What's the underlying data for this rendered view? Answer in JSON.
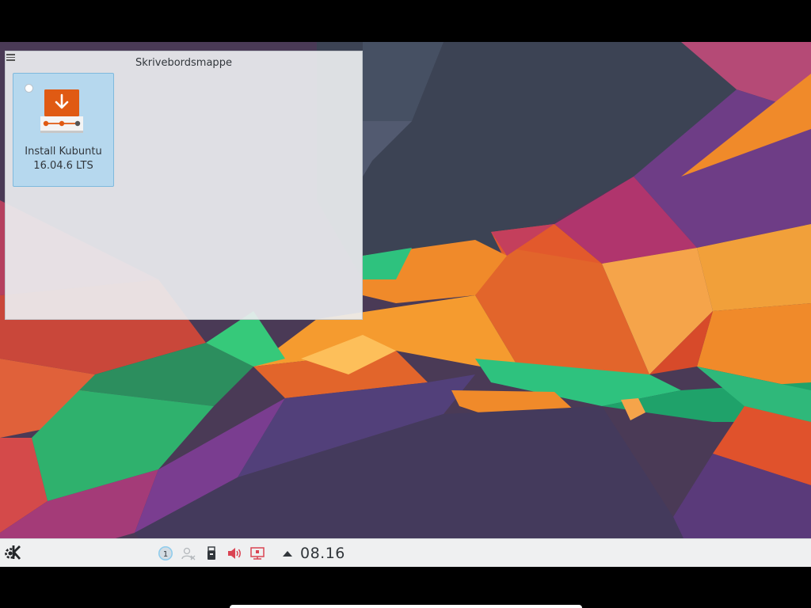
{
  "desktop": {
    "folder_view": {
      "title": "Skrivebordsmappe",
      "items": [
        {
          "label_line1": "Install Kubuntu",
          "label_line2": "16.04.6 LTS",
          "icon": "installer-download-icon"
        }
      ]
    }
  },
  "panel": {
    "launcher_icon": "kde-logo-icon",
    "tray": {
      "notifications_count": "1",
      "icons": [
        "notifications-icon",
        "user-switch-icon",
        "usb-device-icon",
        "volume-muted-icon",
        "network-disconnected-icon",
        "show-hidden-arrow-icon"
      ]
    },
    "clock": "08.16"
  },
  "colors": {
    "panel_bg": "#eff0f1",
    "selection_bg": "#afd7f0",
    "installer_orange": "#e05a13",
    "tray_red": "#da4453"
  }
}
